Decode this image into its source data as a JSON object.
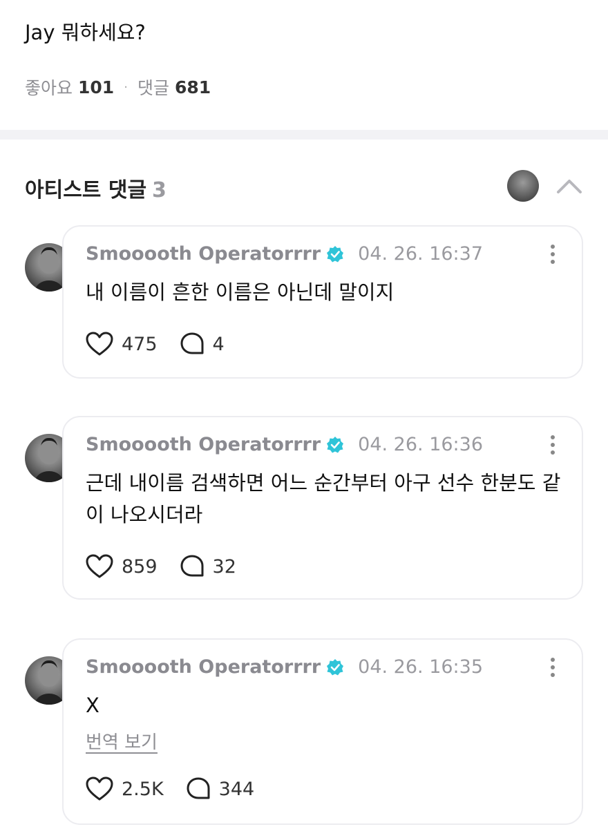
{
  "post": {
    "text": "Jay 뭐하세요?",
    "likes_label": "좋아요",
    "likes_count": "101",
    "separator": "·",
    "comments_label": "댓글",
    "comments_count": "681"
  },
  "artist_section": {
    "title": "아티스트 댓글",
    "count": "3",
    "collapse_icon": "chevron-up-icon"
  },
  "comments": [
    {
      "author": "Smooooth Operatorrrr",
      "verified_icon": "verified-badge-icon",
      "time": "04. 26. 16:37",
      "text": "내 이름이 흔한 이름은 아닌데 말이지",
      "translate": "",
      "likes": "475",
      "replies": "4"
    },
    {
      "author": "Smooooth Operatorrrr",
      "verified_icon": "verified-badge-icon",
      "time": "04. 26. 16:36",
      "text": "근데 내이름 검색하면 어느 순간부터 아구 선수 한분도 같이 나오시더라",
      "translate": "",
      "likes": "859",
      "replies": "32"
    },
    {
      "author": "Smooooth Operatorrrr",
      "verified_icon": "verified-badge-icon",
      "time": "04. 26. 16:35",
      "text": "X",
      "translate": "번역 보기",
      "likes": "2.5K",
      "replies": "344"
    }
  ],
  "colors": {
    "verified": "#2fc4d8",
    "muted": "#8e8e93",
    "divider": "#f2f2f5"
  }
}
